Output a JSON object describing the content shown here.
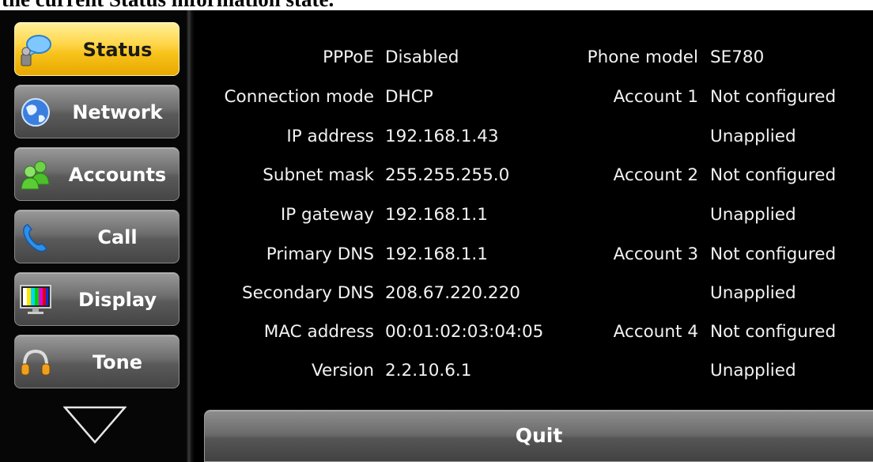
{
  "caption": "the current Status information state.",
  "sidebar": {
    "items": [
      {
        "label": "Status",
        "active": true
      },
      {
        "label": "Network",
        "active": false
      },
      {
        "label": "Accounts",
        "active": false
      },
      {
        "label": "Call",
        "active": false
      },
      {
        "label": "Display",
        "active": false
      },
      {
        "label": "Tone",
        "active": false
      }
    ],
    "more_icon": "triangle-down-icon"
  },
  "network_info": [
    {
      "label": "PPPoE",
      "value": "Disabled"
    },
    {
      "label": "Connection mode",
      "value": "DHCP"
    },
    {
      "label": "IP address",
      "value": "192.168.1.43"
    },
    {
      "label": "Subnet mask",
      "value": "255.255.255.0"
    },
    {
      "label": "IP gateway",
      "value": "192.168.1.1"
    },
    {
      "label": "Primary DNS",
      "value": "192.168.1.1"
    },
    {
      "label": "Secondary DNS",
      "value": "208.67.220.220"
    },
    {
      "label": "MAC address",
      "value": "00:01:02:03:04:05"
    },
    {
      "label": "Version",
      "value": "2.2.10.6.1"
    }
  ],
  "device_info": {
    "phone_model_label": "Phone model",
    "phone_model_value": "SE780",
    "accounts": [
      {
        "label": "Account 1",
        "status": "Not configured",
        "state": "Unapplied"
      },
      {
        "label": "Account 2",
        "status": "Not configured",
        "state": "Unapplied"
      },
      {
        "label": "Account 3",
        "status": "Not configured",
        "state": "Unapplied"
      },
      {
        "label": "Account 4",
        "status": "Not configured",
        "state": "Unapplied"
      }
    ]
  },
  "quit_label": "Quit",
  "colors": {
    "active_tab": "#f6c21a",
    "tab": "#6d6d6d",
    "screen_bg": "#000000",
    "text": "#f2f2f2"
  }
}
